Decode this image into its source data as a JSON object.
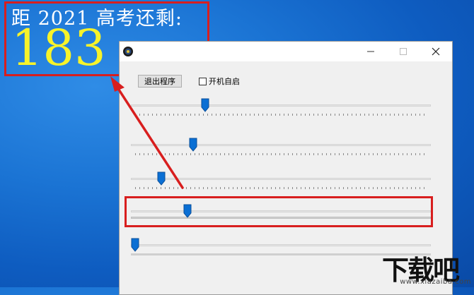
{
  "overlay": {
    "title_text": "距 2021 高考还剩:",
    "days_remaining": "183",
    "title_color": "#ffffff",
    "number_color": "#f7f32a",
    "highlight_color": "#d81e1e"
  },
  "window": {
    "exit_button_label": "退出程序",
    "autostart_label": "开机自启",
    "autostart_checked": false,
    "sliders": [
      {
        "name": "slider-1",
        "value_fraction": 0.24
      },
      {
        "name": "slider-2",
        "value_fraction": 0.2
      },
      {
        "name": "slider-3",
        "value_fraction": 0.09
      },
      {
        "name": "slider-4",
        "value_fraction": 0.18
      },
      {
        "name": "slider-5",
        "value_fraction": 0.0
      }
    ],
    "controls": {
      "minimize": "minimize-icon",
      "maximize": "maximize-icon",
      "close": "close-icon"
    },
    "accent_color": "#0a6fd4"
  },
  "watermark": {
    "text": "下载吧",
    "url": "www.xiazaiba.com"
  }
}
